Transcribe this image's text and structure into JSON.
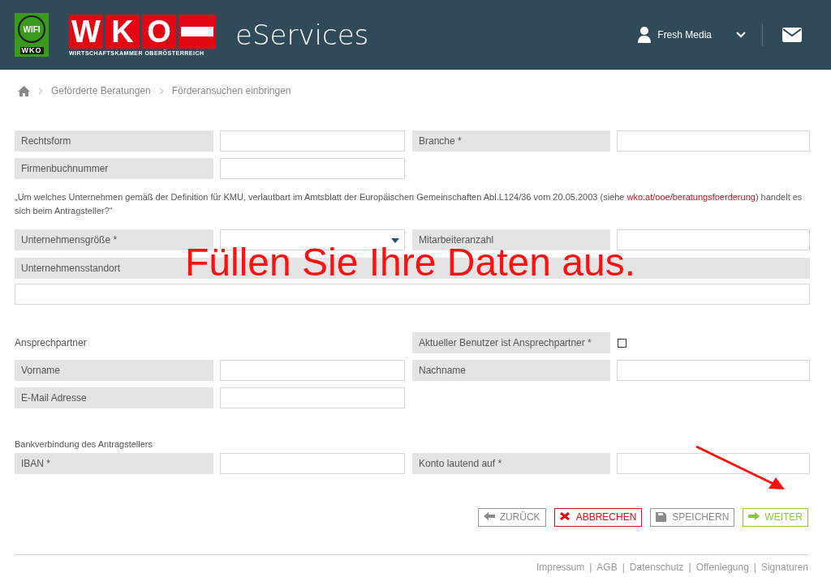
{
  "header": {
    "wifi_logo": "WIFI",
    "wifi_logo_sub": "WKO",
    "wko_letters": [
      "W",
      "K",
      "O"
    ],
    "wko_subtitle": "WIRTSCHAFTSKAMMER OBERÖSTERREICH",
    "app_title": "eServices",
    "user": "Fresh Media"
  },
  "breadcrumb": [
    "Geförderte Beratungen",
    "Förderansuchen einbringen"
  ],
  "sections": [
    {
      "rows": [
        {
          "kind": "fields",
          "fields": [
            {
              "kind": "input",
              "label": "Rechtsform"
            },
            {
              "kind": "input",
              "label": "Branche *"
            }
          ]
        },
        {
          "kind": "fields",
          "fields": [
            {
              "kind": "input",
              "label": "Firmenbuchnummer"
            }
          ]
        },
        {
          "kind": "note",
          "text": "„Um welches Unternehmen gemäß der Definition für KMU, verlautbart im Amtsblatt der Europäischen Gemeinschaften Abl.L124/36 vom 20.05.2003 (siehe ",
          "link": "wko.at/ooe/beratungsfoerderung",
          "text_after": ") handelt es sich beim Antragsteller?“"
        },
        {
          "kind": "fields",
          "fields": [
            {
              "kind": "select",
              "label": "Unternehmensgröße *"
            },
            {
              "kind": "input",
              "label": "Mitarbeiteranzahl"
            }
          ]
        },
        {
          "kind": "wide",
          "label": "Unternehmensstandort"
        }
      ]
    },
    {
      "rows": [
        {
          "kind": "fields",
          "fields": [
            {
              "kind": "caption",
              "label": "Ansprechpartner"
            },
            {
              "kind": "checkbox",
              "label": "Aktueller Benutzer ist Ansprechpartner *",
              "checked": false
            }
          ]
        },
        {
          "kind": "fields",
          "fields": [
            {
              "kind": "input",
              "label": "Vorname"
            },
            {
              "kind": "input",
              "label": "Nachname"
            }
          ]
        },
        {
          "kind": "fields",
          "fields": [
            {
              "kind": "input",
              "label": "E-Mail Adresse"
            }
          ]
        }
      ]
    },
    {
      "rows": [
        {
          "kind": "heading",
          "text": "Bankverbindung des Antragstellers"
        },
        {
          "kind": "fields",
          "fields": [
            {
              "kind": "input",
              "label": "IBAN *"
            },
            {
              "kind": "input",
              "label": "Konto lautend auf *"
            }
          ]
        }
      ]
    }
  ],
  "buttons": [
    {
      "kind": "back",
      "label": "ZURÜCK"
    },
    {
      "kind": "cancel",
      "label": "ABBRECHEN"
    },
    {
      "kind": "save",
      "label": "SPEICHERN"
    },
    {
      "kind": "next",
      "label": "WEITER"
    }
  ],
  "footer": {
    "links": [
      "Impressum",
      "AGB",
      "Datenschutz",
      "Offenlegung",
      "Signaturen"
    ],
    "separator": "|"
  },
  "annotation": {
    "text": "Füllen Sie Ihre Daten aus."
  }
}
